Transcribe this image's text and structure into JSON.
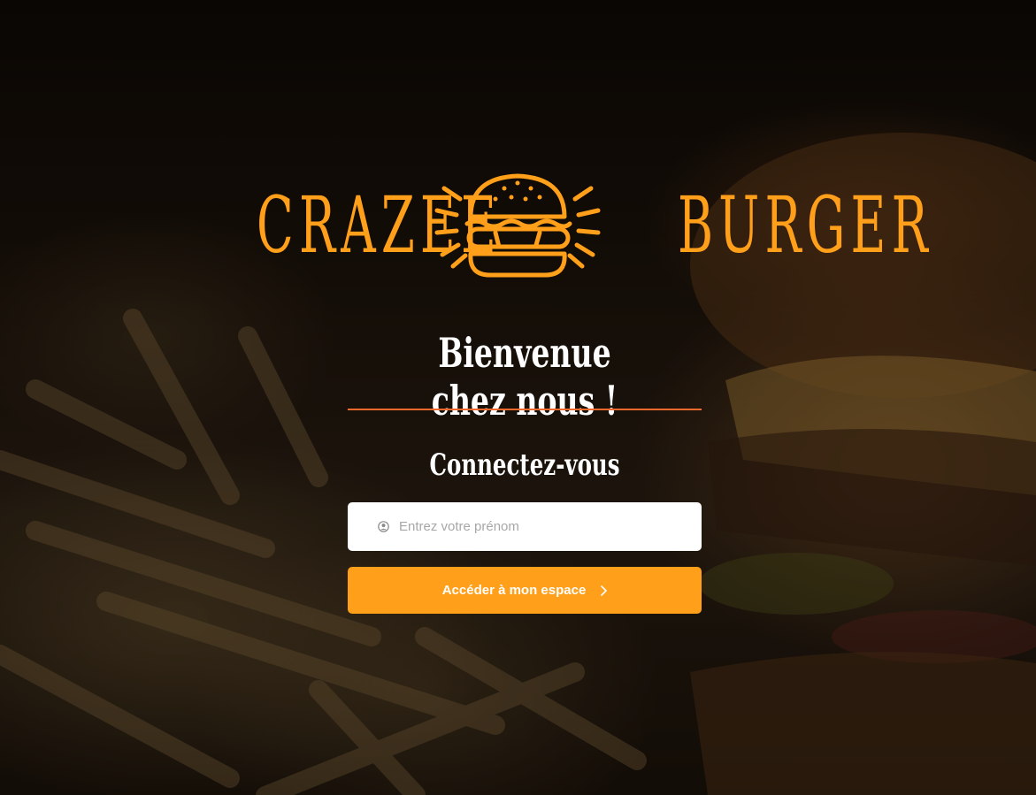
{
  "brand": {
    "name_left": "CRAZEE",
    "name_right": "BURGER",
    "logo_icon": "burger-icon",
    "accent_color": "#ff9f1a"
  },
  "welcome": {
    "title": "Bienvenue chez nous !",
    "divider_color": "#f56a2c"
  },
  "login": {
    "subtitle": "Connectez-vous",
    "input_placeholder": "Entrez votre prénom",
    "input_icon": "user-circle-icon",
    "submit_label": "Accéder à mon espace",
    "submit_icon": "chevron-right-icon"
  },
  "background": {
    "subject": "burger-and-fries-photo"
  }
}
